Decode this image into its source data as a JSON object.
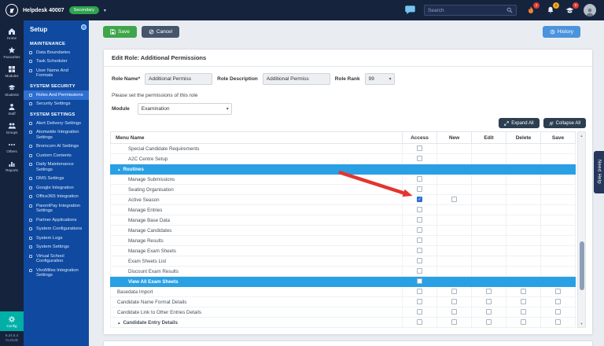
{
  "topbar": {
    "brand": "Helpdesk 40007",
    "env_badge": "Secondary",
    "search_placeholder": "Search",
    "alert_badge": "4",
    "bell_badge": "1",
    "cap_badge": "0"
  },
  "rail": {
    "items": [
      {
        "label": "Home",
        "icon": "home-icon"
      },
      {
        "label": "Favourites",
        "icon": "star-icon"
      },
      {
        "label": "Modules",
        "icon": "modules-icon"
      },
      {
        "label": "Students",
        "icon": "students-icon"
      },
      {
        "label": "Staff",
        "icon": "staff-icon"
      },
      {
        "label": "Groups",
        "icon": "groups-icon"
      },
      {
        "label": "Others",
        "icon": "others-icon"
      },
      {
        "label": "Reports",
        "icon": "reports-icon"
      }
    ],
    "config_label": "Config",
    "version": "9.24.5.4",
    "edition": "CLOUD"
  },
  "sidebar": {
    "title": "Setup",
    "sections": [
      {
        "heading": "MAINTENANCE",
        "items": [
          {
            "label": "Data Boundaries"
          },
          {
            "label": "Task Scheduler"
          },
          {
            "label": "User Name And Formats"
          }
        ]
      },
      {
        "heading": "SYSTEM SECURITY",
        "items": [
          {
            "label": "Roles And Permissions",
            "active": true
          },
          {
            "label": "Security Settings"
          }
        ]
      },
      {
        "heading": "SYSTEM SETTINGS",
        "items": [
          {
            "label": "Alert Delivery Settings"
          },
          {
            "label": "Atomwide Integration Settings"
          },
          {
            "label": "Bromcom AI Settings"
          },
          {
            "label": "Custom Contents"
          },
          {
            "label": "Daily Maintenance Settings"
          },
          {
            "label": "DMS Settings"
          },
          {
            "label": "Google Integration"
          },
          {
            "label": "Office365 Integration"
          },
          {
            "label": "ParentPay Integration Settings"
          },
          {
            "label": "Partner Applications"
          },
          {
            "label": "System Configurations"
          },
          {
            "label": "System Logs"
          },
          {
            "label": "System Settings"
          },
          {
            "label": "Virtual School Configuration"
          },
          {
            "label": "VivoMiles Integration Settings"
          }
        ]
      }
    ]
  },
  "actions": {
    "save": "Save",
    "cancel": "Cancel",
    "history": "History"
  },
  "panel": {
    "title": "Edit Role: Additional Permissions",
    "role_name_label": "Role Name*",
    "role_name_value": "Additional Permiss",
    "role_description_label": "Role Description",
    "role_description_value": "Additional Permiss",
    "role_rank_label": "Role Rank",
    "role_rank_value": "99",
    "note": "Please set the permissions of this role",
    "module_label": "Module",
    "module_value": "Examination",
    "expand_all": "Expand All",
    "collapse_all": "Collapse All"
  },
  "need_help": "Need Help",
  "table": {
    "columns": [
      "Menu Name",
      "Access",
      "New",
      "Edit",
      "Delete",
      "Save"
    ],
    "rows": [
      {
        "label": "Special Candidate Requirements",
        "kind": "item",
        "indent": 1,
        "cells": [
          "unchecked",
          "none",
          "none",
          "none",
          "none"
        ]
      },
      {
        "label": "A2C Centre Setup",
        "kind": "item",
        "indent": 1,
        "cells": [
          "unchecked",
          "none",
          "none",
          "none",
          "none"
        ]
      },
      {
        "label": "Routines",
        "kind": "group",
        "indent": 0,
        "cells": [
          "none",
          "none",
          "none",
          "none",
          "none"
        ]
      },
      {
        "label": "Manage Submissions",
        "kind": "item",
        "indent": 1,
        "cells": [
          "unchecked",
          "none",
          "none",
          "none",
          "none"
        ]
      },
      {
        "label": "Seating Organisation",
        "kind": "item",
        "indent": 1,
        "cells": [
          "unchecked",
          "none",
          "none",
          "none",
          "none"
        ]
      },
      {
        "label": "Active Season",
        "kind": "item",
        "indent": 1,
        "cells": [
          "checked",
          "unchecked",
          "none",
          "none",
          "none"
        ]
      },
      {
        "label": "Manage Entries",
        "kind": "item",
        "indent": 1,
        "cells": [
          "unchecked",
          "none",
          "none",
          "none",
          "none"
        ]
      },
      {
        "label": "Manage Base Data",
        "kind": "item",
        "indent": 1,
        "cells": [
          "unchecked",
          "none",
          "none",
          "none",
          "none"
        ]
      },
      {
        "label": "Manage Candidates",
        "kind": "item",
        "indent": 1,
        "cells": [
          "unchecked",
          "none",
          "none",
          "none",
          "none"
        ]
      },
      {
        "label": "Manage Results",
        "kind": "item",
        "indent": 1,
        "cells": [
          "unchecked",
          "none",
          "none",
          "none",
          "none"
        ]
      },
      {
        "label": "Manage Exam Sheets",
        "kind": "item",
        "indent": 1,
        "cells": [
          "unchecked",
          "none",
          "none",
          "none",
          "none"
        ]
      },
      {
        "label": "Exam Sheets List",
        "kind": "item",
        "indent": 1,
        "cells": [
          "unchecked",
          "none",
          "none",
          "none",
          "none"
        ]
      },
      {
        "label": "Discount Exam Results",
        "kind": "item",
        "indent": 1,
        "cells": [
          "unchecked",
          "none",
          "none",
          "none",
          "none"
        ]
      },
      {
        "label": "View All Exam Sheets",
        "kind": "highlight",
        "indent": 1,
        "cells": [
          "unchecked",
          "none",
          "none",
          "none",
          "none"
        ]
      },
      {
        "label": "Basedata Import",
        "kind": "item",
        "indent": 0,
        "cells": [
          "unchecked",
          "unchecked",
          "unchecked",
          "unchecked",
          "unchecked"
        ]
      },
      {
        "label": "Candidate Name Format Details",
        "kind": "item",
        "indent": 0,
        "cells": [
          "unchecked",
          "unchecked",
          "unchecked",
          "unchecked",
          "unchecked"
        ]
      },
      {
        "label": "Candidate Link to Other Entries Details",
        "kind": "item",
        "indent": 0,
        "cells": [
          "unchecked",
          "unchecked",
          "unchecked",
          "unchecked",
          "unchecked"
        ]
      },
      {
        "label": "Candidate Entry Details",
        "kind": "group-light",
        "indent": 0,
        "cells": [
          "unchecked",
          "unchecked",
          "unchecked",
          "unchecked",
          "unchecked"
        ]
      }
    ]
  }
}
